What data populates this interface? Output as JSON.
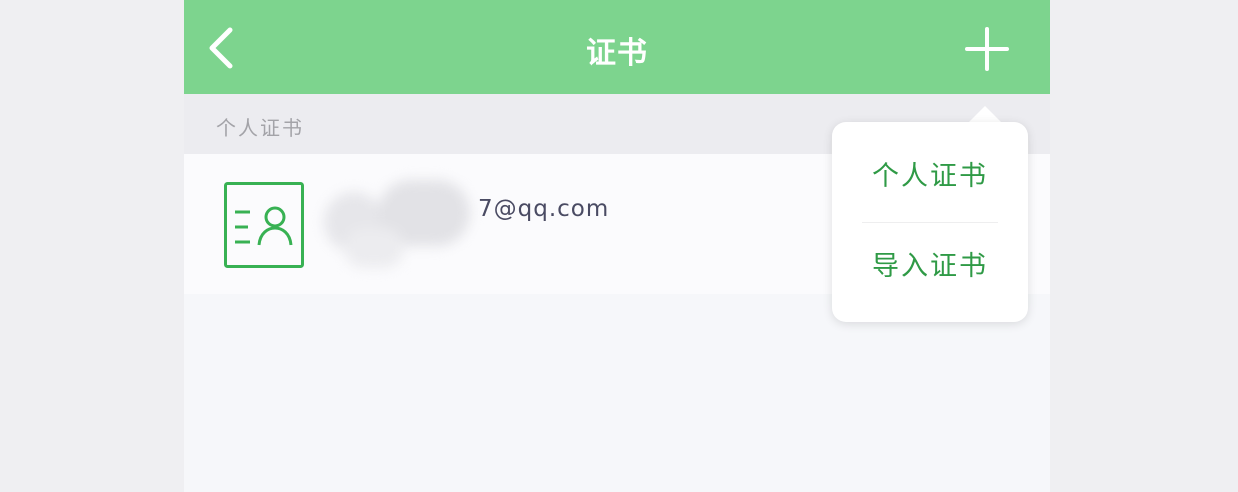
{
  "navbar": {
    "title": "证书",
    "back_icon": "chevron-left-icon",
    "add_icon": "plus-icon",
    "background_color": "#7dd48e"
  },
  "section": {
    "label": "个人证书"
  },
  "certificate": {
    "icon": "id-card-icon",
    "email_visible_suffix": "7@qq.com",
    "accent_color": "#38b153"
  },
  "popover_menu": {
    "items": [
      {
        "label": "个人证书"
      },
      {
        "label": "导入证书"
      }
    ],
    "text_color": "#2f9a46"
  }
}
